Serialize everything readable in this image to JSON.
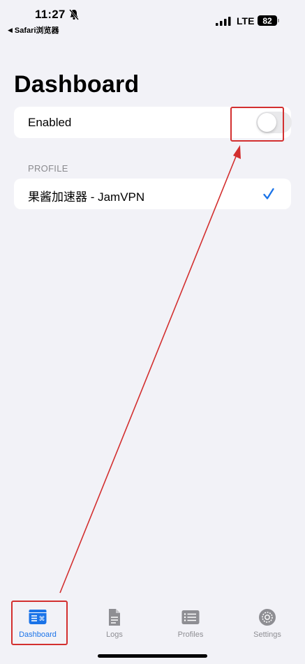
{
  "status_bar": {
    "time": "11:27",
    "back_app": "Safari浏览器",
    "network": "LTE",
    "battery": "82"
  },
  "page": {
    "title": "Dashboard"
  },
  "vpn": {
    "enabled_label": "Enabled",
    "enabled": false
  },
  "profile_section": {
    "header": "PROFILE",
    "selected_profile": "果酱加速器 - JamVPN"
  },
  "tabs": [
    {
      "label": "Dashboard",
      "icon": "dashboard-icon",
      "active": true
    },
    {
      "label": "Logs",
      "icon": "document-icon",
      "active": false
    },
    {
      "label": "Profiles",
      "icon": "list-icon",
      "active": false
    },
    {
      "label": "Settings",
      "icon": "gear-icon",
      "active": false
    }
  ],
  "colors": {
    "accent": "#1a73e8",
    "annotation": "#d32f2f",
    "background": "#f2f2f7"
  }
}
